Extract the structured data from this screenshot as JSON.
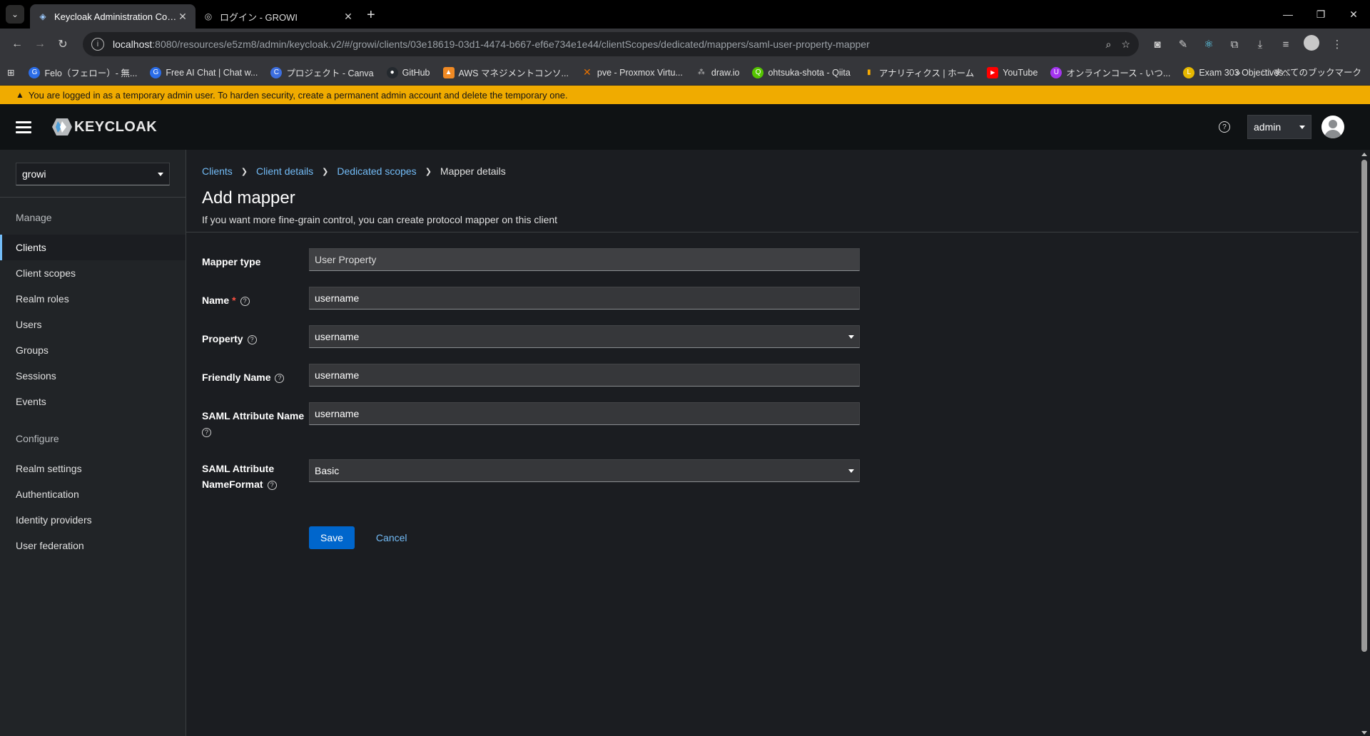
{
  "browser": {
    "tabs": [
      {
        "title": "Keycloak Administration Console",
        "active": true
      },
      {
        "title": "ログイン - GROWI",
        "active": false
      }
    ],
    "url_host": "localhost",
    "url_rest": ":8080/resources/e5zm8/admin/keycloak.v2/#/growi/clients/03e18619-03d1-4474-b667-ef6e734e1e44/clientScopes/dedicated/mappers/saml-user-property-mapper",
    "bookmarks": [
      {
        "label": "Felo（フェロー）- 無...",
        "color": "#2b6de8"
      },
      {
        "label": "Free AI Chat | Chat w...",
        "color": "#2b6de8"
      },
      {
        "label": "プロジェクト - Canva",
        "color": "#3d6fe0"
      },
      {
        "label": "GitHub",
        "color": "#24292e"
      },
      {
        "label": "AWS マネジメントコンソ...",
        "color": "#f08a24"
      },
      {
        "label": "pve - Proxmox Virtu...",
        "color": "#e57000"
      },
      {
        "label": "draw.io",
        "color": "#555555"
      },
      {
        "label": "ohtsuka-shota - Qiita",
        "color": "#55c500"
      },
      {
        "label": "アナリティクス | ホーム",
        "color": "#f9ab00"
      },
      {
        "label": "YouTube",
        "color": "#ff0000"
      },
      {
        "label": "オンラインコース - いつ...",
        "color": "#a435f0"
      },
      {
        "label": "Exam 303 Objectives...",
        "color": "#e6b800"
      }
    ],
    "all_bookmarks": "すべてのブックマーク"
  },
  "banner": {
    "text": "You are logged in as a temporary admin user. To harden security, create a permanent admin account and delete the temporary one."
  },
  "header": {
    "logo_text": "KEYCLOAK",
    "user": "admin"
  },
  "sidebar": {
    "realm": "growi",
    "manage_title": "Manage",
    "manage_items": [
      "Clients",
      "Client scopes",
      "Realm roles",
      "Users",
      "Groups",
      "Sessions",
      "Events"
    ],
    "configure_title": "Configure",
    "configure_items": [
      "Realm settings",
      "Authentication",
      "Identity providers",
      "User federation"
    ]
  },
  "breadcrumb": {
    "items": [
      "Clients",
      "Client details",
      "Dedicated scopes"
    ],
    "current": "Mapper details"
  },
  "page": {
    "title": "Add mapper",
    "subtitle": "If you want more fine-grain control, you can create protocol mapper on this client"
  },
  "form": {
    "mapper_type_label": "Mapper type",
    "mapper_type_value": "User Property",
    "name_label": "Name",
    "name_value": "username",
    "property_label": "Property",
    "property_value": "username",
    "friendly_name_label": "Friendly Name",
    "friendly_name_value": "username",
    "saml_attr_name_label": "SAML Attribute Name",
    "saml_attr_name_value": "username",
    "saml_nameformat_label_1": "SAML Attribute",
    "saml_nameformat_label_2": "NameFormat",
    "saml_nameformat_value": "Basic",
    "save_label": "Save",
    "cancel_label": "Cancel"
  }
}
